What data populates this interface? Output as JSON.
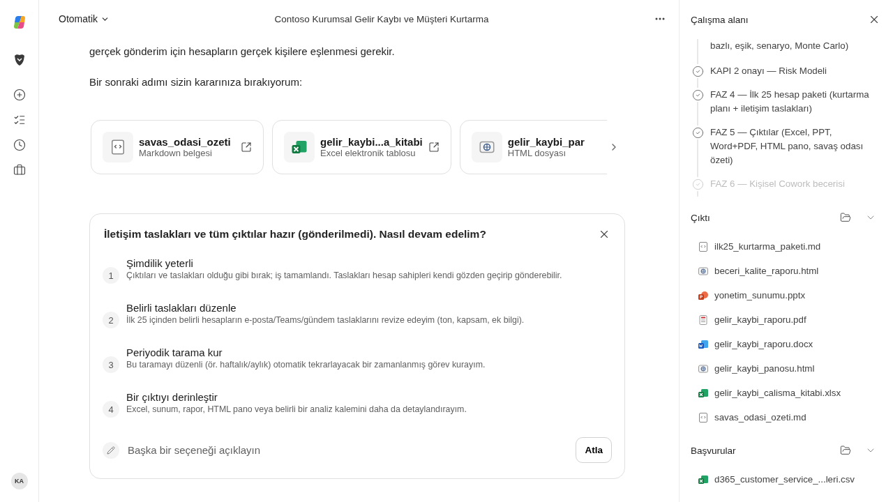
{
  "header": {
    "mode": "Otomatik",
    "title": "Contoso Kurumsal Gelir Kaybı ve Müşteri Kurtarma"
  },
  "rail": {
    "avatar": "KA"
  },
  "chat": {
    "paragraphs": [
      "gerçek gönderim için hesapların gerçek kişilere eşlenmesi gerekir.",
      "Bir sonraki adımı sizin kararınıza bırakıyorum:"
    ]
  },
  "attachments": [
    {
      "name": "savas_odasi_ozeti",
      "type": "Markdown belgesi",
      "kind": "markdown",
      "openable": true
    },
    {
      "name": "gelir_kaybi...a_kitabi",
      "type": "Excel elektronik tablosu",
      "kind": "excel",
      "openable": true
    },
    {
      "name": "gelir_kaybi_par",
      "type": "HTML dosyası",
      "kind": "html",
      "openable": false
    }
  ],
  "question": {
    "title": "İletişim taslakları ve tüm çıktılar hazır (gönderilmedi). Nasıl devam edelim?",
    "options": [
      {
        "number": "1",
        "title": "Şimdilik yeterli",
        "description": "Çıktıları ve taslakları olduğu gibi bırak; iş tamamlandı. Taslakları hesap sahipleri kendi gözden geçirip gönderebilir."
      },
      {
        "number": "2",
        "title": "Belirli taslakları düzenle",
        "description": "İlk 25 içinden belirli hesapların e-posta/Teams/gündem taslaklarını revize edeyim (ton, kapsam, ek bilgi)."
      },
      {
        "number": "3",
        "title": "Periyodik tarama kur",
        "description": "Bu taramayı düzenli (ör. haftalık/aylık) otomatik tekrarlayacak bir zamanlanmış görev kurayım."
      },
      {
        "number": "4",
        "title": "Bir çıktıyı derinleştir",
        "description": "Excel, sunum, rapor, HTML pano veya belirli bir analiz kalemini daha da detaylandırayım."
      }
    ],
    "other_placeholder": "Başka bir seçeneği açıklayın",
    "skip_label": "Atla"
  },
  "workspace": {
    "title": "Çalışma alanı",
    "step_overflow": "bazlı, eşik, senaryo, Monte Carlo)",
    "steps": [
      {
        "label": "KAPI 2 onayı — Risk Modeli",
        "done": true
      },
      {
        "label": "FAZ 4 — İlk 25 hesap paketi (kurtarma planı + iletişim taslakları)",
        "done": true
      },
      {
        "label": "FAZ 5 — Çıktılar (Excel, PPT, Word+PDF, HTML pano, savaş odası özeti)",
        "done": true
      },
      {
        "label": "FAZ 6 — Kişisel Cowork becerisi",
        "done": false
      }
    ],
    "sections": [
      {
        "title": "Çıktı",
        "expanded": true,
        "files": [
          {
            "name": "ilk25_kurtarma_paketi.md",
            "kind": "markdown"
          },
          {
            "name": "beceri_kalite_raporu.html",
            "kind": "html"
          },
          {
            "name": "yonetim_sunumu.pptx",
            "kind": "powerpoint"
          },
          {
            "name": "gelir_kaybi_raporu.pdf",
            "kind": "pdf"
          },
          {
            "name": "gelir_kaybi_raporu.docx",
            "kind": "word"
          },
          {
            "name": "gelir_kaybi_panosu.html",
            "kind": "html"
          },
          {
            "name": "gelir_kaybi_calisma_kitabi.xlsx",
            "kind": "excel"
          },
          {
            "name": "savas_odasi_ozeti.md",
            "kind": "markdown"
          }
        ]
      },
      {
        "title": "Başvurular",
        "expanded": true,
        "files": [
          {
            "name": "d365_customer_service_...leri.csv",
            "kind": "csv"
          }
        ]
      }
    ]
  }
}
